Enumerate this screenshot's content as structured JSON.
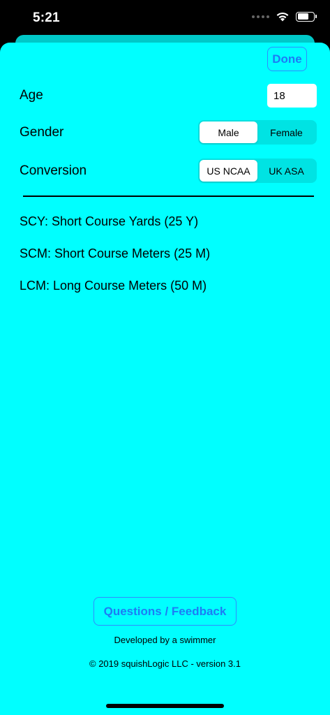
{
  "status_bar": {
    "time": "5:21"
  },
  "header": {
    "done_label": "Done"
  },
  "settings": {
    "age": {
      "label": "Age",
      "value": "18"
    },
    "gender": {
      "label": "Gender",
      "options": [
        "Male",
        "Female"
      ],
      "selected": "Male"
    },
    "conversion": {
      "label": "Conversion",
      "options": [
        "US NCAA",
        "UK ASA"
      ],
      "selected": "US NCAA"
    }
  },
  "info": [
    "SCY: Short Course Yards (25 Y)",
    "SCM: Short Course Meters (25 M)",
    "LCM: Long Course Meters (50 M)"
  ],
  "footer": {
    "feedback_label": "Questions / Feedback",
    "developer_text": "Developed by a swimmer",
    "copyright_text": "© 2019 squishLogic LLC - version 3.1"
  },
  "colors": {
    "background": "#00ffff",
    "accent": "#1c7cf5",
    "segment_track": "#00e3e3"
  }
}
